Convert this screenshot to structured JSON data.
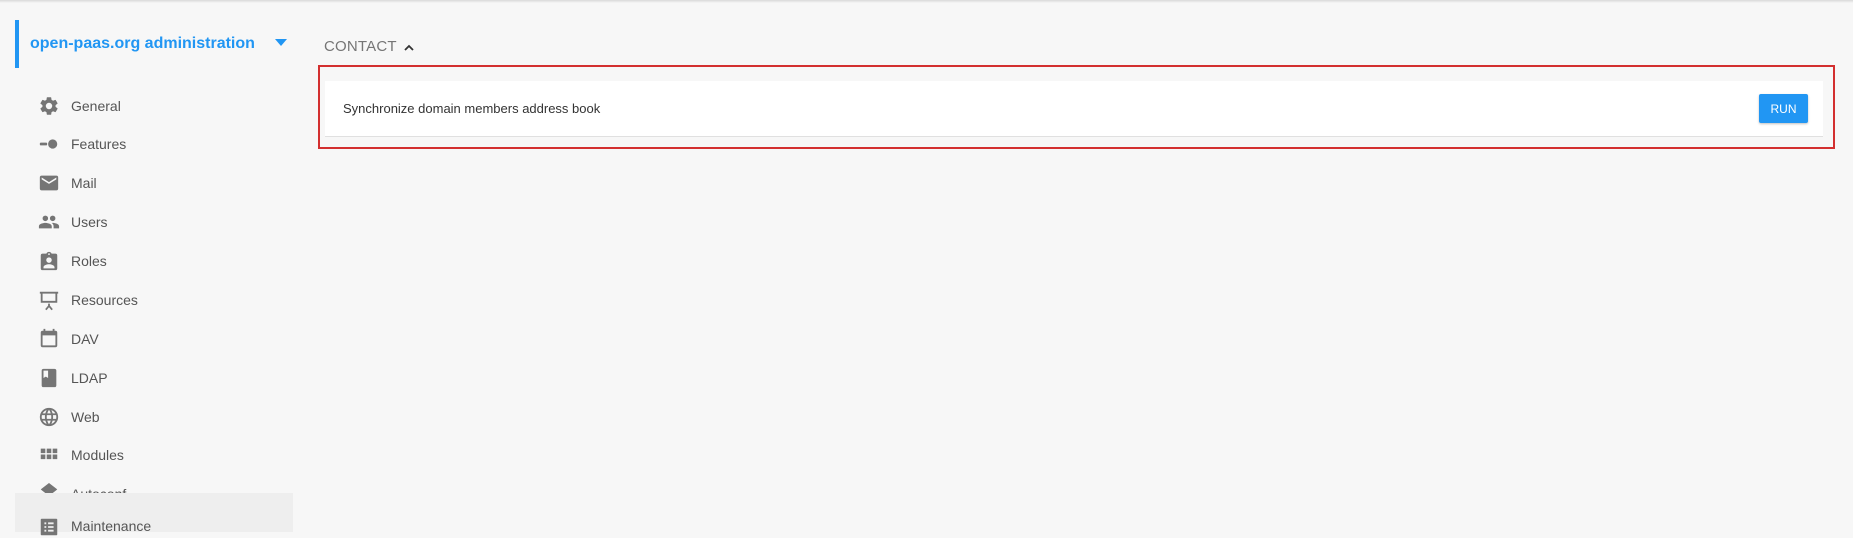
{
  "sidebar": {
    "domain_title": "open-paas.org administration",
    "items": [
      {
        "label": "General",
        "icon": "gear-icon"
      },
      {
        "label": "Features",
        "icon": "toggle-icon"
      },
      {
        "label": "Mail",
        "icon": "mail-icon"
      },
      {
        "label": "Users",
        "icon": "users-icon"
      },
      {
        "label": "Roles",
        "icon": "badge-icon"
      },
      {
        "label": "Resources",
        "icon": "easel-icon"
      },
      {
        "label": "DAV",
        "icon": "calendar-icon"
      },
      {
        "label": "LDAP",
        "icon": "book-icon"
      },
      {
        "label": "Web",
        "icon": "globe-icon"
      },
      {
        "label": "Modules",
        "icon": "grid-icon"
      },
      {
        "label": "Autoconf",
        "icon": "layers-icon"
      },
      {
        "label": "Maintenance",
        "icon": "list-icon"
      }
    ],
    "active_item": "Maintenance"
  },
  "main": {
    "section_title": "CONTACT",
    "task_label": "Synchronize domain members address book",
    "run_label": "RUN"
  },
  "colors": {
    "accent": "#2196f3",
    "highlight": "#d32f2f"
  }
}
